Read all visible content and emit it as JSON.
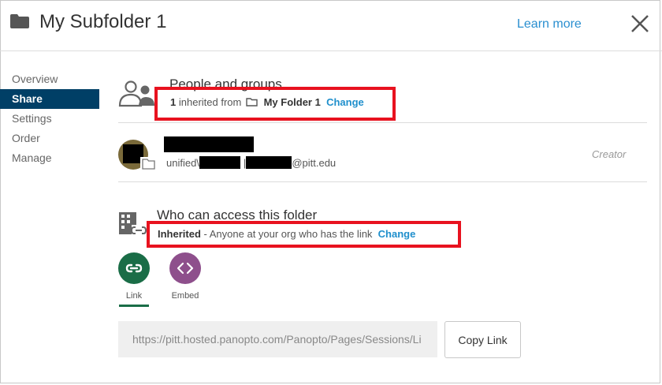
{
  "header": {
    "title": "My Subfolder 1",
    "learn_more": "Learn more",
    "folder_icon": "folder-icon",
    "close_icon": "close-icon"
  },
  "sidebar": {
    "items": [
      {
        "label": "Overview",
        "active": false
      },
      {
        "label": "Share",
        "active": true
      },
      {
        "label": "Settings",
        "active": false
      },
      {
        "label": "Order",
        "active": false
      },
      {
        "label": "Manage",
        "active": false
      }
    ]
  },
  "people": {
    "title": "People and groups",
    "inherited_count": "1",
    "inherited_from_label": "inherited from",
    "parent_folder": "My Folder 1",
    "change_label": "Change",
    "user": {
      "name": "",
      "sub_prefix": "unified\\",
      "sub_sep": "|",
      "email_suffix": "@pitt.edu",
      "role": "Creator"
    }
  },
  "access": {
    "title": "Who can access this folder",
    "level": "Inherited",
    "description": "- Anyone at your org who has the link",
    "change_label": "Change"
  },
  "share_options": [
    {
      "label": "Link",
      "icon": "link-icon",
      "color": "#1a6d47",
      "selected": true
    },
    {
      "label": "Embed",
      "icon": "code-icon",
      "color": "#8e4f8c",
      "selected": false
    }
  ],
  "link": {
    "url": "https://pitt.hosted.panopto.com/Panopto/Pages/Sessions/Li",
    "copy_label": "Copy Link"
  },
  "colors": {
    "accent": "#1f8fcc",
    "nav_active": "#003f66",
    "highlight": "#e8121f"
  }
}
